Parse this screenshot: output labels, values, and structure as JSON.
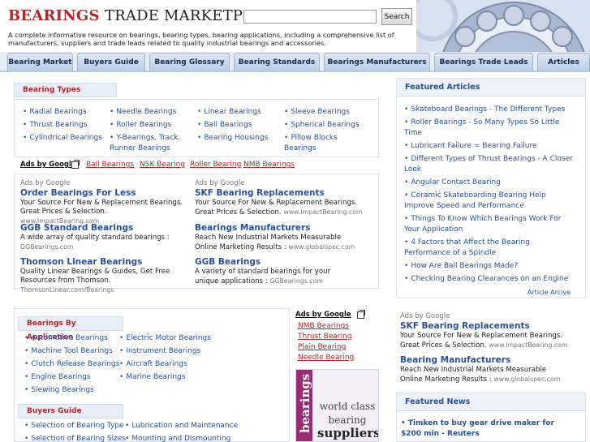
{
  "header": {
    "logo_word1": "BEARINGS",
    "logo_word2": "TRADE MARKETPLACE",
    "search_placeholder": "",
    "search_button": "Search",
    "tagline": "A complete informative resource on bearings, bearing types, bearing applications, including a comprehensive list of manufacturers, suppliers and trade leads related to quality industrial bearings and accessories."
  },
  "nav": {
    "tabs": [
      {
        "label": "Bearing Market"
      },
      {
        "label": "Buyers Guide"
      },
      {
        "label": "Bearing Glossary"
      },
      {
        "label": "Bearing Standards"
      },
      {
        "label": "Bearings Manufacturers"
      },
      {
        "label": "Bearings Trade Leads"
      },
      {
        "label": "Articles"
      }
    ]
  },
  "bearing_types": {
    "title": "Bearing Types",
    "col1": [
      "Radial Bearings",
      "Thrust Bearings",
      "Cylindrical Bearings"
    ],
    "col2": [
      "Needle Bearings",
      "Roller Bearings",
      "Y-Bearings, Track Runner Bearings"
    ],
    "col3": [
      "Linear Bearings",
      "Ball Bearings",
      "Bearing Housings"
    ],
    "col4": [
      "Sleeve Bearings",
      "Spherical Bearings",
      "Pillow Blocks Bearings"
    ]
  },
  "ad_links_top": {
    "label": "Ads by Google",
    "links": [
      "Ball Bearings",
      "NSK Bearing",
      "Roller Bearing",
      "NMB Bearings"
    ]
  },
  "google_ads": {
    "by_label": "Ads by Google",
    "left": [
      {
        "title": "Order Bearings For Less",
        "body": "Your Source For New & Replacement Bearings. Great Prices & Selection.",
        "url": "www.ImpactBearing.com"
      },
      {
        "title": "GGB Standard Bearings",
        "body": "A wide array of quality standard bearings :",
        "url": "GGBearings.com"
      },
      {
        "title": "Thomson Linear Bearings",
        "body": "Quality Linear Bearings & Guides, Get Free Resources from Thomson.",
        "url": "ThomsonLinear.com/Bearings"
      }
    ],
    "right": [
      {
        "title": "SKF Bearing Replacements",
        "body": "Your Source For New & Replacement Bearings. Great Prices & Selection.",
        "url": "www.ImpactBearing.com"
      },
      {
        "title": "Bearings Manufacturers",
        "body": "Reach New Industrial Markets Measurable Online Marketing Results :",
        "url": "www.globalspec.com"
      },
      {
        "title": "GGB Bearings",
        "body": "A variety of standard bearings for your unique applications :",
        "url": "GGBearings.com"
      }
    ]
  },
  "by_application": {
    "title": "Bearings By Application",
    "col1": [
      "Automotive Bearings",
      "Machine Tool Bearings",
      "Clutch Release Bearings",
      "Engine Bearings",
      "Slewing Bearings"
    ],
    "col2": [
      "Electric Motor Bearings",
      "Instrument Bearings",
      "Aircraft Bearings",
      "Marine Bearings"
    ]
  },
  "buyers_guide": {
    "title": "Buyers Guide",
    "col1": [
      "Selection of Bearing Type",
      "Selection of Bearing Sizes"
    ],
    "col2": [
      "Lubrication and Maintenance",
      "Mounting and Dismounting"
    ]
  },
  "side_ads": {
    "label": "Ads by Google",
    "links": [
      "NMB Bearings",
      "Thrust Bearing",
      "Plain Bearing",
      "Needle Bearing"
    ]
  },
  "banner": {
    "vertical_text": "bearings",
    "line1": "world class",
    "line2": "bearing",
    "line3": "suppliers"
  },
  "featured_articles": {
    "title": "Featured Articles",
    "items": [
      "Skateboard Bearings - The Different Types",
      "Roller Bearings - So Many Types So Little Time",
      "Lubricant Failure = Bearing Failure",
      "Different Types of Thrust Bearings - A Closer Look",
      "Angular Contact Bearing",
      "Ceramic Skateboarding Bearing Help Improve Speed and Performance",
      "Things To Know Which Bearings Work For Your Application",
      "4 Factors that Affect the Bearing Performance of a Spindle",
      "How Are Ball Bearings Made?",
      "Checking Bearing Clearances on an Engine"
    ],
    "archive_label": "Article Arcive"
  },
  "right_ads": {
    "by_label": "Ads by Google",
    "items": [
      {
        "title": "SKF Bearing Replacements",
        "body": "Your Source For New & Replacement Bearings. Great Prices & Selection.",
        "url": "www.ImpactBearing.com"
      },
      {
        "title": "Bearing Manufacturers",
        "body": "Reach New Industrial Markets Measurable Online Marketing Results :",
        "url": "www.globalspec.com"
      }
    ]
  },
  "featured_news": {
    "title": "Featured News",
    "items": [
      "Timken to buy gear drive maker for $200 min - Reuters"
    ]
  },
  "colors": {
    "brand_red": "#b0282e",
    "link_blue": "#2a4f9a",
    "nav_blue": "#b8cbe4"
  }
}
